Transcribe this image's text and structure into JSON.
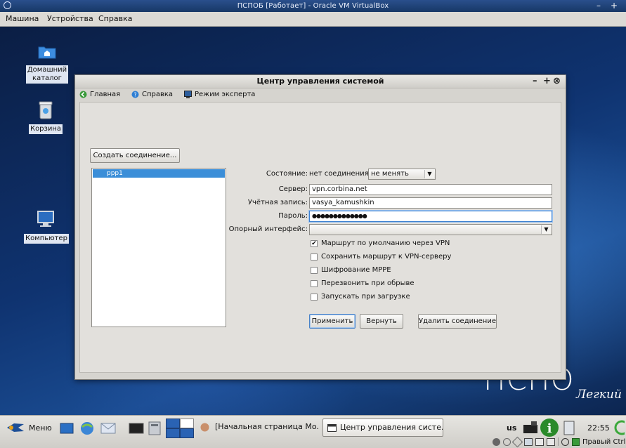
{
  "host": {
    "title": "ПСПОБ [Работает] - Oracle VM VirtualBox",
    "controls": {
      "minimize": "–",
      "maximize": "+"
    },
    "menu": [
      "Машина",
      "Устройства",
      "Справка"
    ]
  },
  "desktop": {
    "icons": [
      {
        "label_line1": "Домашний",
        "label_line2": "каталог",
        "icon": "home-folder-icon"
      },
      {
        "label": "Корзина",
        "icon": "trash-icon"
      },
      {
        "label": "Компьютер",
        "icon": "computer-icon"
      }
    ],
    "brand_big": "ПСПО",
    "brand_small": "Легкий"
  },
  "window": {
    "title": "Центр управления системой",
    "controls": {
      "minimize": "–",
      "maximize": "+",
      "close": "⊗"
    },
    "toolbar": [
      {
        "label": "Главная",
        "icon": "home-arrow-icon"
      },
      {
        "label": "Справка",
        "icon": "help-icon"
      },
      {
        "label": "Режим эксперта",
        "icon": "expert-mode-icon"
      }
    ],
    "create_button": "Создать соединение...",
    "connections": [
      "ppp1"
    ],
    "form": {
      "state_label": "Состояние:",
      "state_value": "нет соединения",
      "state_action": "не менять",
      "server_label": "Сервер:",
      "server_value": "vpn.corbina.net",
      "account_label": "Учётная запись:",
      "account_value": "vasya_kamushkin",
      "password_label": "Пароль:",
      "password_value": "●●●●●●●●●●●●●",
      "interface_label": "Опорный интерфейс:",
      "interface_value": ""
    },
    "checkboxes": [
      {
        "label": "Маршрут по умолчанию через VPN",
        "checked": true
      },
      {
        "label": "Сохранить маршрут к VPN-серверу",
        "checked": false
      },
      {
        "label": "Шифрование MPPE",
        "checked": false
      },
      {
        "label": "Перезвонить при обрыве",
        "checked": false
      },
      {
        "label": "Запускать при загрузке",
        "checked": false
      }
    ],
    "buttons": {
      "apply": "Применить",
      "revert": "Вернуть",
      "delete": "Удалить соединение"
    }
  },
  "taskbar": {
    "menu_label": "Меню",
    "tasks": [
      "[Начальная страница Mo...",
      "Центр управления систе..."
    ],
    "layout": "us",
    "clock": "22:55",
    "host_key": "Правый Ctrl"
  }
}
